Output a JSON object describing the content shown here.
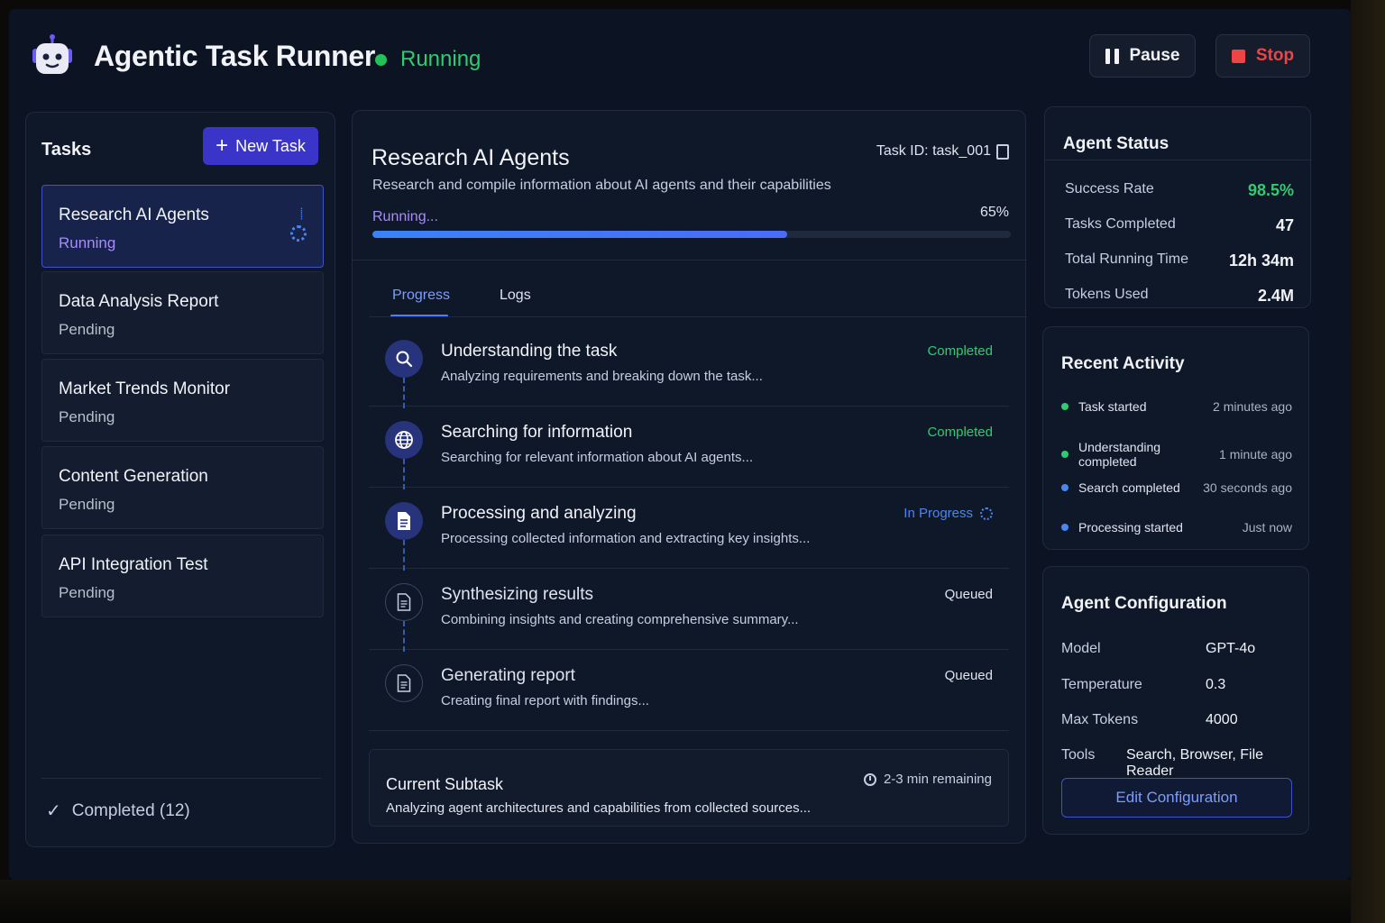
{
  "header": {
    "app_title": "Agentic Task Runner",
    "run_status": "Running",
    "pause_label": "Pause",
    "stop_label": "Stop"
  },
  "tasks": {
    "title": "Tasks",
    "new_task_label": "New Task",
    "items": [
      {
        "name": "Research AI Agents",
        "status": "Running"
      },
      {
        "name": "Data Analysis Report",
        "status": "Pending"
      },
      {
        "name": "Market Trends Monitor",
        "status": "Pending"
      },
      {
        "name": "Content Generation",
        "status": "Pending"
      },
      {
        "name": "API Integration Test",
        "status": "Pending"
      }
    ],
    "completed_label": "Completed (12)"
  },
  "main": {
    "title": "Research AI Agents",
    "task_id": "Task ID: task_001",
    "description": "Research and compile information about AI agents and their capabilities",
    "status_label": "Running...",
    "progress_percent_label": "65%",
    "progress_fraction": 0.65,
    "tabs": [
      {
        "label": "Progress"
      },
      {
        "label": "Logs"
      }
    ],
    "steps": [
      {
        "title": "Understanding the task",
        "desc": "Analyzing requirements and breaking down the task...",
        "status": "Completed",
        "icon": "search-icon"
      },
      {
        "title": "Searching for information",
        "desc": "Searching for relevant information about AI agents...",
        "status": "Completed",
        "icon": "globe-icon"
      },
      {
        "title": "Processing and analyzing",
        "desc": "Processing collected information and extracting key insights...",
        "status": "In Progress",
        "icon": "document-icon"
      },
      {
        "title": "Synthesizing results",
        "desc": "Combining insights and creating comprehensive summary...",
        "status": "Queued",
        "icon": "document-outline-icon"
      },
      {
        "title": "Generating report",
        "desc": "Creating final report with findings...",
        "status": "Queued",
        "icon": "document-outline-icon"
      }
    ],
    "current_subtask": {
      "title": "Current Subtask",
      "desc": "Analyzing agent architectures and capabilities from collected sources...",
      "time_remaining": "2-3 min remaining"
    }
  },
  "agent_status": {
    "title": "Agent Status",
    "stats": [
      {
        "label": "Success Rate",
        "value": "98.5%"
      },
      {
        "label": "Tasks Completed",
        "value": "47"
      },
      {
        "label": "Total Running Time",
        "value": "12h 34m"
      },
      {
        "label": "Tokens Used",
        "value": "2.4M"
      }
    ]
  },
  "recent_activity": {
    "title": "Recent Activity",
    "items": [
      {
        "text": "Task started",
        "time": "2 minutes ago",
        "color": "#2ecc71"
      },
      {
        "text": "Understanding completed",
        "time": "1 minute ago",
        "color": "#2ecc71"
      },
      {
        "text": "Search completed",
        "time": "30 seconds ago",
        "color": "#4a86f0"
      },
      {
        "text": "Processing started",
        "time": "Just now",
        "color": "#4a86f0"
      }
    ]
  },
  "agent_config": {
    "title": "Agent Configuration",
    "rows": [
      {
        "label": "Model",
        "value": "GPT-4o"
      },
      {
        "label": "Temperature",
        "value": "0.3"
      },
      {
        "label": "Max Tokens",
        "value": "4000"
      },
      {
        "label": "Tools",
        "value": "Search, Browser, File Reader"
      }
    ],
    "edit_label": "Edit Configuration"
  },
  "colors": {
    "accent": "#3a35c8",
    "success": "#2ecc71",
    "danger": "#ef4444",
    "info": "#4a86f0",
    "running": "#a78bfa"
  }
}
